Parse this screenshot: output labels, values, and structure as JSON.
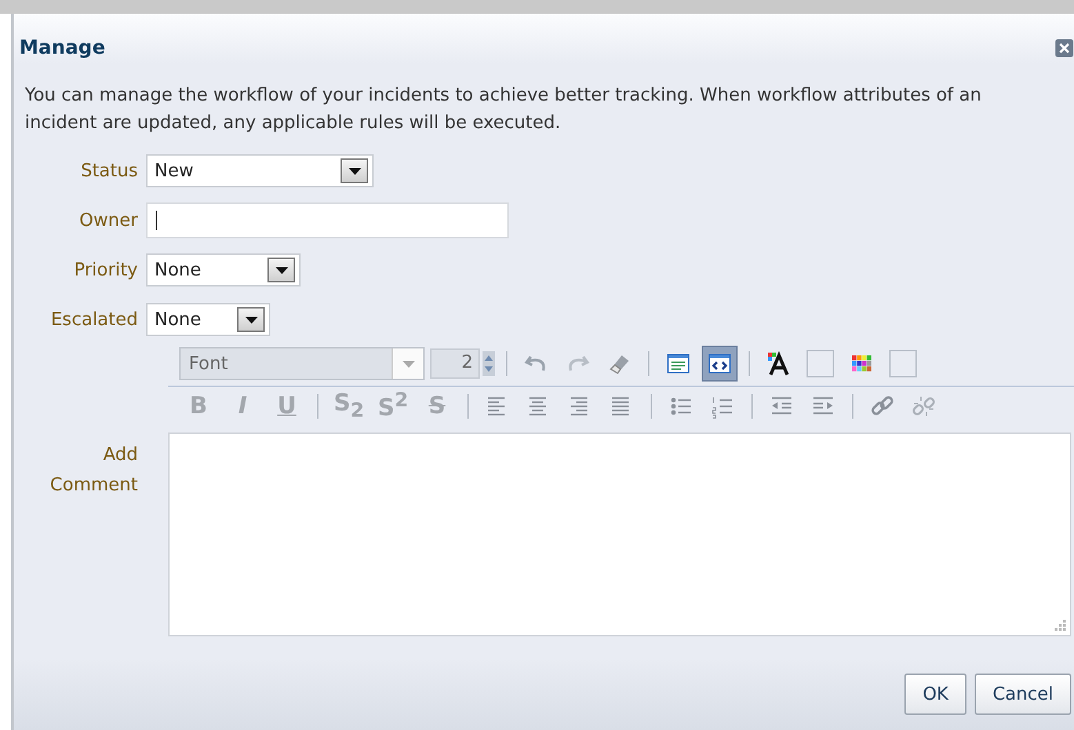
{
  "dialog": {
    "title": "Manage",
    "description": "You can manage the workflow of your incidents to achieve better tracking. When workflow attributes of an incident are updated, any applicable rules will be executed."
  },
  "fields": [
    {
      "kind": "select",
      "label": "Status",
      "value": "New"
    },
    {
      "kind": "text",
      "label": "Owner"
    },
    {
      "kind": "select",
      "label": "Priority",
      "value": "None"
    },
    {
      "kind": "select",
      "label": "Escalated",
      "value": "None"
    }
  ],
  "editor": {
    "label": "Add Comment",
    "toolbar_rows": [
      [
        {
          "kind": "font",
          "text": "Font"
        },
        {
          "kind": "spinner",
          "text": "2"
        },
        {
          "kind": "sep"
        },
        {
          "kind": "undo"
        },
        {
          "kind": "redo"
        },
        {
          "kind": "eraser"
        },
        {
          "kind": "sep"
        },
        {
          "kind": "design",
          "selected": false
        },
        {
          "kind": "source",
          "selected": true
        },
        {
          "kind": "sep"
        },
        {
          "kind": "textcolor"
        },
        {
          "kind": "swatch"
        },
        {
          "kind": "bgcolor"
        },
        {
          "kind": "swatch"
        }
      ],
      [
        {
          "kind": "bold",
          "text": "B"
        },
        {
          "kind": "italic",
          "text": "I"
        },
        {
          "kind": "underline",
          "text": "U"
        },
        {
          "kind": "sep"
        },
        {
          "kind": "rich",
          "text": "S$_{2}$"
        },
        {
          "kind": "rich",
          "text": "S$^{2}$"
        },
        {
          "kind": "strike",
          "text": "S"
        },
        {
          "kind": "sep"
        },
        {
          "kind": "alignleft"
        },
        {
          "kind": "aligncenter"
        },
        {
          "kind": "alignright"
        },
        {
          "kind": "justify"
        },
        {
          "kind": "sep"
        },
        {
          "kind": "bullets"
        },
        {
          "kind": "numbers"
        },
        {
          "kind": "sep"
        },
        {
          "kind": "outdent"
        },
        {
          "kind": "indent"
        },
        {
          "kind": "sep"
        },
        {
          "kind": "link"
        },
        {
          "kind": "unlink"
        }
      ]
    ]
  },
  "buttons": [
    "OK",
    "Cancel"
  ]
}
